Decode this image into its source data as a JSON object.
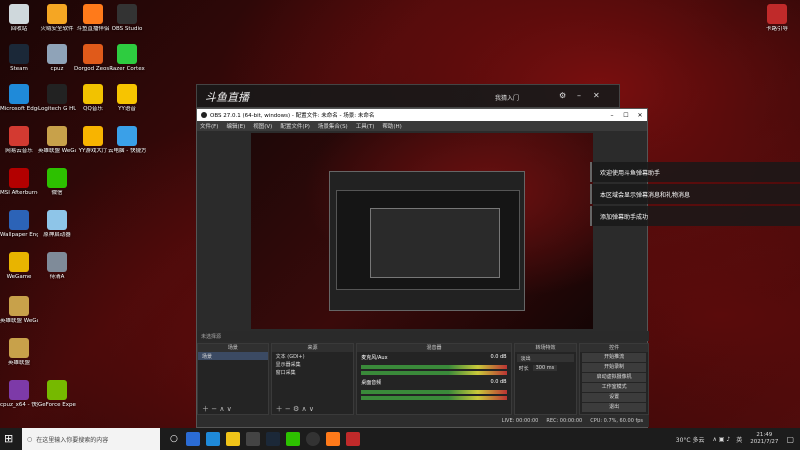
{
  "desktop_icons": [
    {
      "label": "回收站",
      "color": "#cfd8dc"
    },
    {
      "label": "火绒安全软件",
      "color": "#f5a623"
    },
    {
      "label": "斗鱼直播伴侣",
      "color": "#ff7a1a"
    },
    {
      "label": "OBS Studio",
      "color": "#333333"
    },
    {
      "label": "Steam",
      "color": "#1b2838"
    },
    {
      "label": "cpuz",
      "color": "#8fa3b8"
    },
    {
      "label": "Dorgod Zeos Engine",
      "color": "#e05a1a"
    },
    {
      "label": "Razer Cortex",
      "color": "#2ecc40"
    },
    {
      "label": "Microsoft Edge",
      "color": "#1f8ad9"
    },
    {
      "label": "Logitech G HUB",
      "color": "#222222"
    },
    {
      "label": "QQ音乐",
      "color": "#f2c200"
    },
    {
      "label": "YY语音",
      "color": "#f7c400"
    },
    {
      "label": "网易云音乐",
      "color": "#d33a31"
    },
    {
      "label": "英雄联盟 WeGame版",
      "color": "#c8a14a"
    },
    {
      "label": "YY游戏大厅",
      "color": "#f8b400"
    },
    {
      "label": "云电脑 - 快捷方式",
      "color": "#3aa0e8"
    },
    {
      "label": "MSI Afterburner",
      "color": "#b30000"
    },
    {
      "label": "微信",
      "color": "#2dc100"
    },
    {
      "label": "Wallpaper Engine",
      "color": "#2c63b7"
    },
    {
      "label": "原神启动器",
      "color": "#8ec5e8"
    },
    {
      "label": "WeGame",
      "color": "#e8b400"
    },
    {
      "label": "待清A",
      "color": "#7f8b99"
    },
    {
      "label": "英雄联盟 WeGame版",
      "color": "#c8a14a"
    },
    {
      "label": "英雄联盟",
      "color": "#c8a14a"
    },
    {
      "label": "cpuz_x64 - 快捷方式",
      "color": "#7d3aa8"
    },
    {
      "label": "GeForce Experience",
      "color": "#76b900"
    }
  ],
  "top_right_icon": {
    "label": "卡路引导",
    "color": "#c02a2a"
  },
  "douyu": {
    "user": "我猜入门",
    "title": "斗鱼直播伴侣"
  },
  "obs": {
    "title": "OBS 27.0.1 (64-bit, windows) - 配置文件: 未命名 - 场景: 未命名",
    "menu": [
      "文件(F)",
      "编辑(E)",
      "视图(V)",
      "配置文件(P)",
      "场景集合(S)",
      "工具(T)",
      "帮助(H)"
    ],
    "scene_label": "未选择源",
    "docks": {
      "scenes": {
        "header": "场景",
        "items": [
          "场景"
        ]
      },
      "sources": {
        "header": "来源",
        "items": [
          "文本 (GDI+)",
          "显示器采集",
          "窗口采集"
        ]
      },
      "mixer": {
        "header": "混音器",
        "tracks": [
          {
            "name": "麦克风/Aux",
            "db": "0.0 dB"
          },
          {
            "name": "桌面音频",
            "db": "0.0 dB"
          }
        ]
      },
      "transitions": {
        "header": "转场特效",
        "type": "淡出",
        "duration_label": "时长",
        "duration": "300 ms"
      },
      "controls": {
        "header": "控件",
        "buttons": [
          "开始推流",
          "开始录制",
          "启动虚拟摄像机",
          "工作室模式",
          "设置",
          "退出"
        ]
      }
    },
    "status": {
      "live": "LIVE: 00:00:00",
      "rec": "REC: 00:00:00",
      "cpu": "CPU: 0.7%, 60.00 fps"
    }
  },
  "notifications": [
    "欢迎使用斗鱼弹幕助手",
    "本区域会显示弹幕消息和礼物消息",
    "添加弹幕助手成功"
  ],
  "taskbar": {
    "search_placeholder": "在这里输入你要搜索的内容",
    "weather": "30°C 多云",
    "lang": "英",
    "time": "21:49",
    "date": "2021/7/27"
  }
}
